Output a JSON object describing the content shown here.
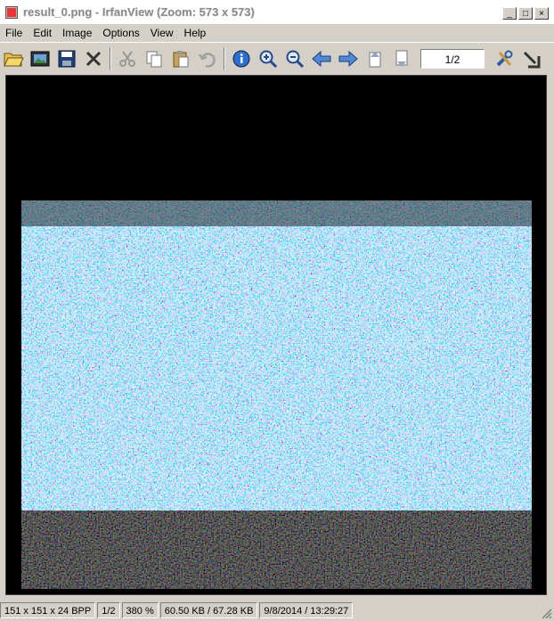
{
  "window": {
    "title": "result_0.png - IrfanView (Zoom: 573 x 573)",
    "min_glyph": "_",
    "max_glyph": "□",
    "close_glyph": "×"
  },
  "menu": {
    "items": [
      "File",
      "Edit",
      "Image",
      "Options",
      "View",
      "Help"
    ]
  },
  "toolbar": {
    "page_indicator": "1/2",
    "icons": [
      "open-folder-icon",
      "slideshow-icon",
      "save-icon",
      "delete-icon",
      "cut-icon",
      "copy-icon",
      "paste-icon",
      "undo-icon",
      "info-icon",
      "zoom-in-icon",
      "zoom-out-icon",
      "previous-icon",
      "next-icon",
      "page-up-icon",
      "page-down-icon",
      "settings-icon",
      "exit-icon"
    ]
  },
  "status": {
    "dimensions": "151 x 151 x 24 BPP",
    "page": "1/2",
    "zoom": "380 %",
    "filesize": "60.50 KB / 67.28 KB",
    "datetime": "9/8/2014 / 13:29:27"
  },
  "colors": {
    "background": "#000000",
    "noise_green": "#6fd98a",
    "noise_magenta": "#c47bd8",
    "noise_cyan": "#5fc9d6",
    "noise_yellow": "#d8d88a"
  }
}
